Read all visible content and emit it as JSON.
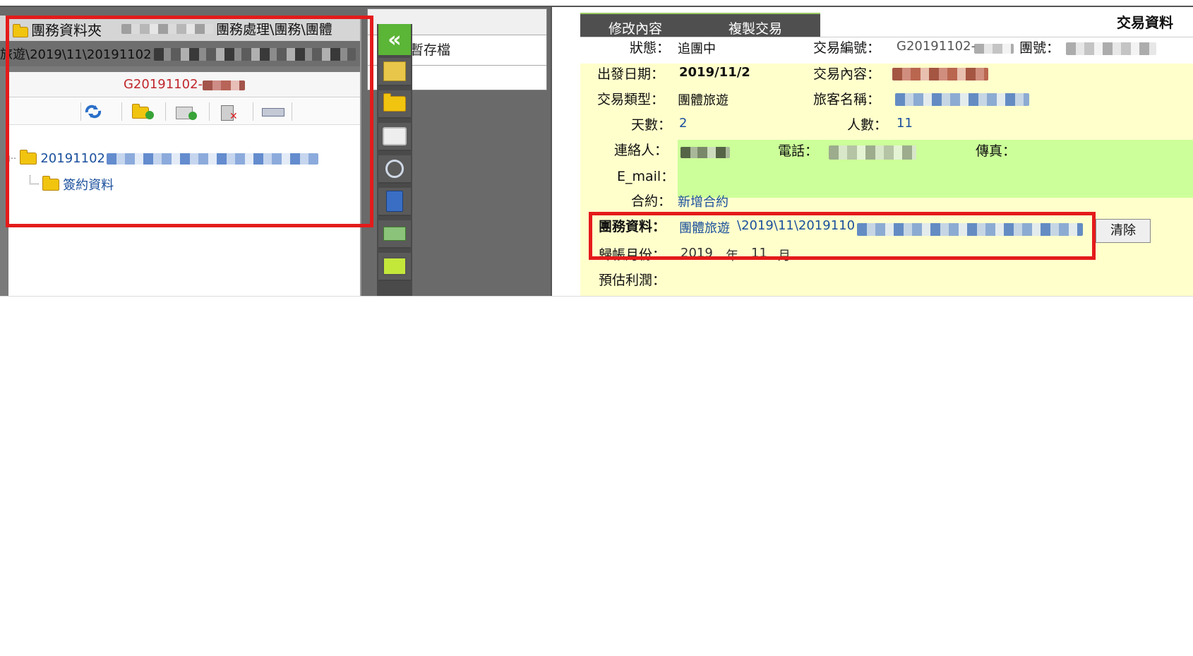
{
  "left_panel": {
    "header_title": "團務資料夾",
    "header_path_suffix": "團務處理\\團務\\團體",
    "path_line": "旅遊\\2019\\11\\20191102",
    "group_code": "G20191102-",
    "tree": {
      "root_label": "20191102",
      "child_label": "簽約資料"
    }
  },
  "back_panel": {
    "save_label": "暫存檔"
  },
  "tabs": {
    "modify": "修改內容",
    "copy": "複製交易"
  },
  "panel_title": "交易資料",
  "form": {
    "status_label": "狀態：",
    "status_value": "追團中",
    "trans_no_label": "交易編號：",
    "trans_no_value": "G20191102-",
    "group_no_label": "團號：",
    "depart_label": "出發日期：",
    "depart_value": "2019/11/2",
    "content_label": "交易內容：",
    "type_label": "交易類型：",
    "type_value": "團體旅遊",
    "traveler_label": "旅客名稱：",
    "days_label": "天數：",
    "days_value": "2",
    "people_label": "人數：",
    "people_value": "11",
    "contact_label": "連絡人：",
    "phone_label": "電話：",
    "fax_label": "傳真：",
    "email_label": "E_mail：",
    "contract_label": "合約：",
    "contract_link": "新增合約",
    "group_data_label": "團務資料：",
    "group_data_link": "團體旅遊",
    "group_data_path": "\\2019\\11\\2019110",
    "clear_button": "清除",
    "account_month_label": "歸帳月份：",
    "account_month_year": "2019",
    "account_month_year_unit": "年",
    "account_month_month": "11",
    "account_month_month_unit": "月",
    "profit_label": "預估利潤："
  },
  "colors": {
    "form_bg": "#ffffcc",
    "contact_bg": "#ccff99",
    "highlight_red": "#e41b1b",
    "toolbar_green": "#5bb536"
  }
}
